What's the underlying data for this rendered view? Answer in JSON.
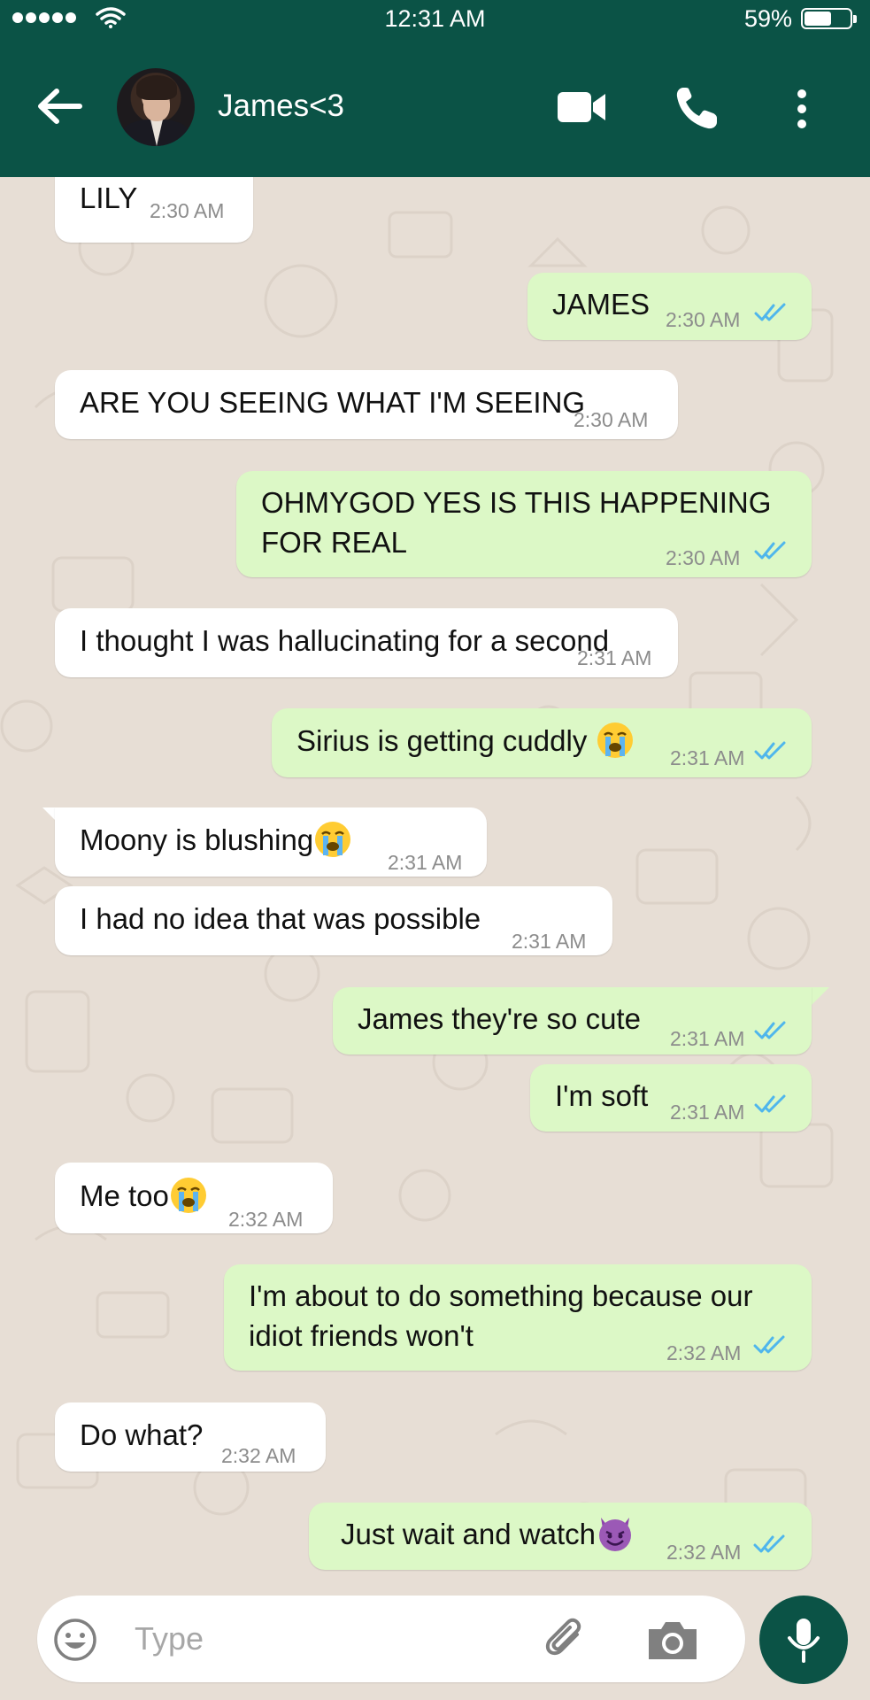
{
  "status_bar": {
    "time": "12:31 AM",
    "battery": "59%",
    "battery_level": 0.59
  },
  "header": {
    "contact_name": "James<3",
    "icons": [
      "back-arrow-icon",
      "avatar",
      "video-camera-icon",
      "phone-icon",
      "more-vert-icon"
    ]
  },
  "messages": [
    {
      "dir": "in",
      "text": "LILY",
      "time": "2:30 AM"
    },
    {
      "dir": "out",
      "text": "JAMES",
      "time": "2:30 AM",
      "status": "read"
    },
    {
      "dir": "in",
      "text": "ARE YOU SEEING WHAT I'M SEEING",
      "time": "2:30 AM"
    },
    {
      "dir": "out",
      "text_line1": "OHMYGOD YES IS THIS HAPPENING",
      "text_line2": "FOR REAL",
      "time": "2:30 AM",
      "status": "read"
    },
    {
      "dir": "in",
      "text": "I thought I was hallucinating for a second",
      "time": "2:31 AM"
    },
    {
      "dir": "out",
      "text": "Sirius is getting cuddly",
      "emoji": "loudly-crying-face",
      "time": "2:31 AM",
      "status": "read"
    },
    {
      "dir": "in",
      "text": "Moony is blushing",
      "emoji": "loudly-crying-face",
      "time": "2:31 AM"
    },
    {
      "dir": "in",
      "text": "I had no idea that was possible",
      "time": "2:31 AM"
    },
    {
      "dir": "out",
      "text": "James they're so cute",
      "time": "2:31 AM",
      "status": "read"
    },
    {
      "dir": "out",
      "text": "I'm soft",
      "time": "2:31 AM",
      "status": "read"
    },
    {
      "dir": "in",
      "text": "Me too",
      "emoji": "loudly-crying-face",
      "time": "2:32 AM"
    },
    {
      "dir": "out",
      "text_line1": "I'm about to do something because our",
      "text_line2": "idiot friends won't",
      "time": "2:32 AM",
      "status": "read"
    },
    {
      "dir": "in",
      "text": "Do what?",
      "time": "2:32 AM"
    },
    {
      "dir": "out",
      "text": "Just wait and watch",
      "emoji": "smiling-face-with-horns",
      "time": "2:32 AM",
      "status": "read"
    }
  ],
  "composer": {
    "placeholder": "Type",
    "icons": [
      "emoji-icon",
      "paperclip-icon",
      "camera-icon",
      "microphone-icon"
    ]
  },
  "colors": {
    "header": "#0b5346",
    "chat_bg": "#e7ded5",
    "incoming": "#ffffff",
    "outgoing": "#dcf8c6",
    "read_tick": "#4fb6ec",
    "mic_button": "#0b5346"
  }
}
